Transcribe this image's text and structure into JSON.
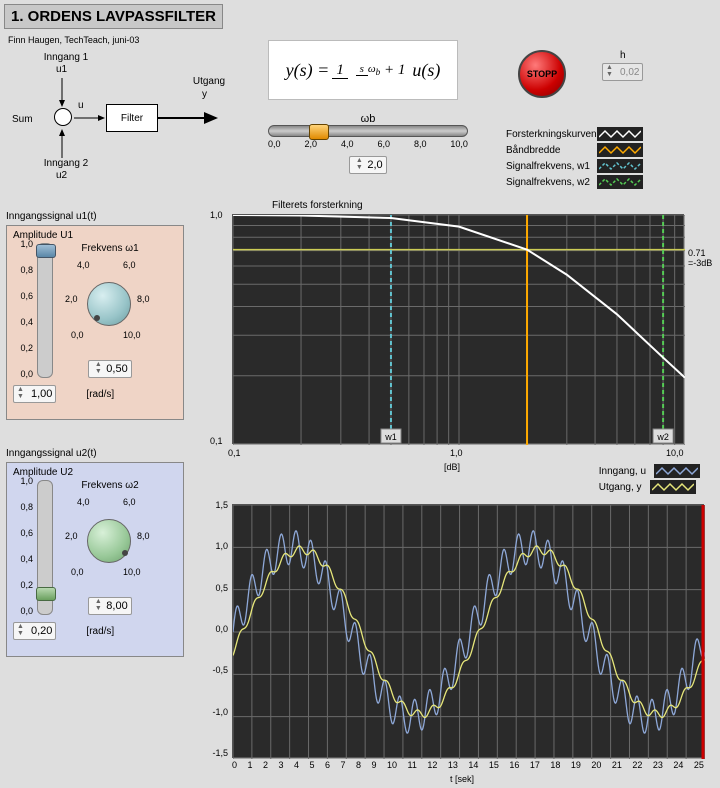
{
  "title": "1. ORDENS LAVPASSFILTER",
  "byline": "Finn Haugen, TechTeach, juni-03",
  "diagram": {
    "inngang1": "Inngang 1",
    "u1": "u1",
    "inngang2": "Inngang 2",
    "u2": "u2",
    "utgang": "Utgang",
    "y": "y",
    "sum": "Sum",
    "u": "u",
    "filter": "Filter"
  },
  "formula": {
    "lhs": "y(s) =",
    "numerator": "1",
    "den_s": "s",
    "den_wb": "ω",
    "den_sub": "b",
    "den_plus": "+ 1",
    "rhs": "u(s)"
  },
  "stop": "STOPP",
  "h": {
    "label": "h",
    "value": "0,02"
  },
  "wb": {
    "label": "ωb",
    "min": "0,0",
    "t1": "2,0",
    "t2": "4,0",
    "t3": "6,0",
    "t4": "8,0",
    "max": "10,0",
    "value": "2,0",
    "slider_pct": 20
  },
  "legend": {
    "forst": "Forsterkningskurven",
    "band": "Båndbredde",
    "sigw1": "Signalfrekvens, w1",
    "sigw2": "Signalfrekvens, w2",
    "colors": {
      "forst": "#ffffff",
      "band": "#ffaa00",
      "sigw1": "#62c4d0",
      "sigw2": "#55cc55"
    }
  },
  "u1_label": "Inngangssignal u1(t)",
  "u2_label": "Inngangssignal u2(t)",
  "panel1": {
    "title": "Amplitude U1",
    "freq_label": "Frekvens ω1",
    "vticks": [
      "1,0",
      "0,8",
      "0,6",
      "0,4",
      "0,2",
      "0,0"
    ],
    "vslider_pct": 0,
    "knob_ticks": {
      "k2": "2,0",
      "k4": "4,0",
      "k6": "6,0",
      "k8": "8,0",
      "k0": "0,0",
      "k10": "10,0"
    },
    "amp_value": "1,00",
    "freq_value": "0,50",
    "unit": "[rad/s]"
  },
  "panel2": {
    "title": "Amplitude U2",
    "freq_label": "Frekvens ω2",
    "vticks": [
      "1,0",
      "0,8",
      "0,6",
      "0,4",
      "0,2",
      "0,0"
    ],
    "vslider_pct": 80,
    "knob_ticks": {
      "k2": "2,0",
      "k4": "4,0",
      "k6": "6,0",
      "k8": "8,0",
      "k0": "0,0",
      "k10": "10,0"
    },
    "amp_value": "0,20",
    "freq_value": "8,00",
    "unit": "[rad/s]"
  },
  "bode": {
    "title": "Filterets forsterkning",
    "xaxis": "[dB]",
    "ymarker": "0.71\n=-3dB",
    "xticks": [
      "0,1",
      "1,0",
      "10,0"
    ],
    "yticks": [
      "1,0",
      "0,1"
    ],
    "w1_label": "w1",
    "w2_label": "w2"
  },
  "time": {
    "xaxis": "t [sek]",
    "inlegend": "Inngang, u",
    "outlegend": "Utgang, y",
    "colors": {
      "in": "#8ea8d8",
      "out": "#e6e67a"
    },
    "xticks": [
      "0",
      "1",
      "2",
      "3",
      "4",
      "5",
      "6",
      "7",
      "8",
      "9",
      "10",
      "11",
      "12",
      "13",
      "14",
      "15",
      "16",
      "17",
      "18",
      "19",
      "20",
      "21",
      "22",
      "23",
      "24",
      "25"
    ],
    "yticks": [
      "1,5",
      "1,0",
      "0,5",
      "0,0",
      "-0,5",
      "-1,0",
      "-1,5"
    ]
  },
  "chart_data": [
    {
      "type": "line",
      "title": "Filterets forsterkning",
      "xscale": "log",
      "yscale": "log",
      "xlim": [
        0.1,
        10.0
      ],
      "ylim": [
        0.1,
        1.0
      ],
      "xlabel": "[dB]",
      "ylabel": "",
      "series": [
        {
          "name": "Forsterkningskurven",
          "color": "#ffffff",
          "x": [
            0.1,
            0.2,
            0.5,
            1.0,
            2.0,
            3.0,
            5.0,
            8.0,
            10.0
          ],
          "y": [
            1.0,
            0.995,
            0.97,
            0.89,
            0.707,
            0.55,
            0.37,
            0.24,
            0.196
          ]
        }
      ],
      "vlines": [
        {
          "name": "Båndbredde",
          "x": 2.0,
          "color": "#ffaa00"
        },
        {
          "name": "w1",
          "x": 0.5,
          "color": "#62c4d0",
          "label": "w1"
        },
        {
          "name": "w2",
          "x": 8.0,
          "color": "#55cc55",
          "label": "w2"
        }
      ],
      "hlines": [
        {
          "y": 0.707,
          "label": "0.71 = -3dB",
          "color": "#cccc55"
        }
      ]
    },
    {
      "type": "line",
      "title": "",
      "xlim": [
        0,
        25
      ],
      "ylim": [
        -1.5,
        1.5
      ],
      "xlabel": "t [sek]",
      "ylabel": "",
      "series": [
        {
          "name": "Inngang, u",
          "color": "#8ea8d8",
          "formula": "1.0*sin(0.5*t)+0.2*sin(8.0*t)"
        },
        {
          "name": "Utgang, y",
          "color": "#e6e67a",
          "formula": "0.97*sin(0.5*t-0.24)+0.048*sin(8.0*t-1.33)"
        }
      ]
    }
  ]
}
